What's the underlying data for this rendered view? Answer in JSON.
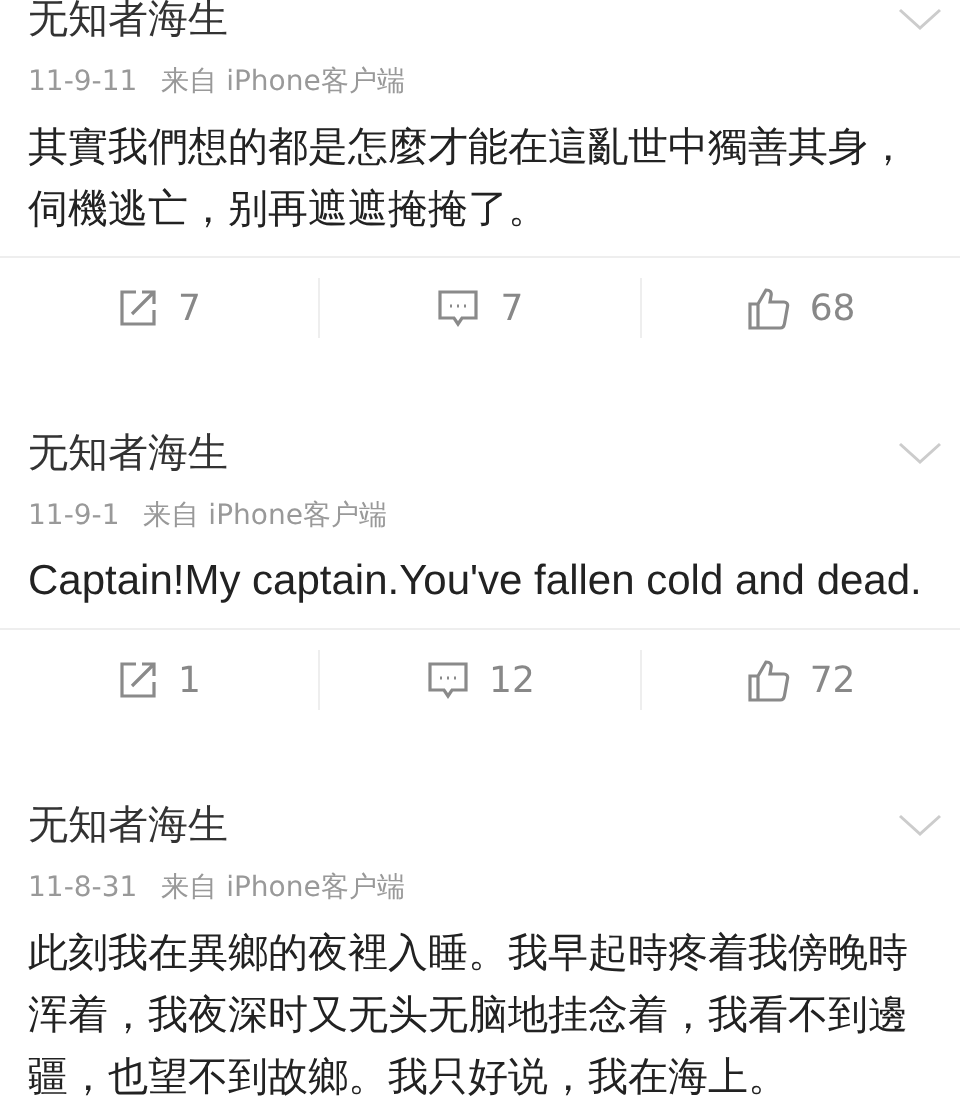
{
  "posts": [
    {
      "author": "无知者海生",
      "time": "11-9-11",
      "source": "来自 iPhone客户端",
      "text": "其實我們想的都是怎麼才能在這亂世中獨善其身，伺機逃亡，别再遮遮掩掩了。",
      "actions": [
        {
          "kind": "repost",
          "count": "7"
        },
        {
          "kind": "comment",
          "count": "7"
        },
        {
          "kind": "like",
          "count": "68"
        }
      ]
    },
    {
      "author": "无知者海生",
      "time": "11-9-1",
      "source": "来自 iPhone客户端",
      "text": "Captain!My captain.You've fallen cold and dead.",
      "actions": [
        {
          "kind": "repost",
          "count": "1"
        },
        {
          "kind": "comment",
          "count": "12"
        },
        {
          "kind": "like",
          "count": "72"
        }
      ]
    },
    {
      "author": "无知者海生",
      "time": "11-8-31",
      "source": "来自 iPhone客户端",
      "text": "此刻我在異鄉的夜裡入睡。我早起時疼着我傍晚時浑着，我夜深时又无头无脑地挂念着，我看不到邊疆，也望不到故鄉。我只好说，我在海上。"
    }
  ]
}
